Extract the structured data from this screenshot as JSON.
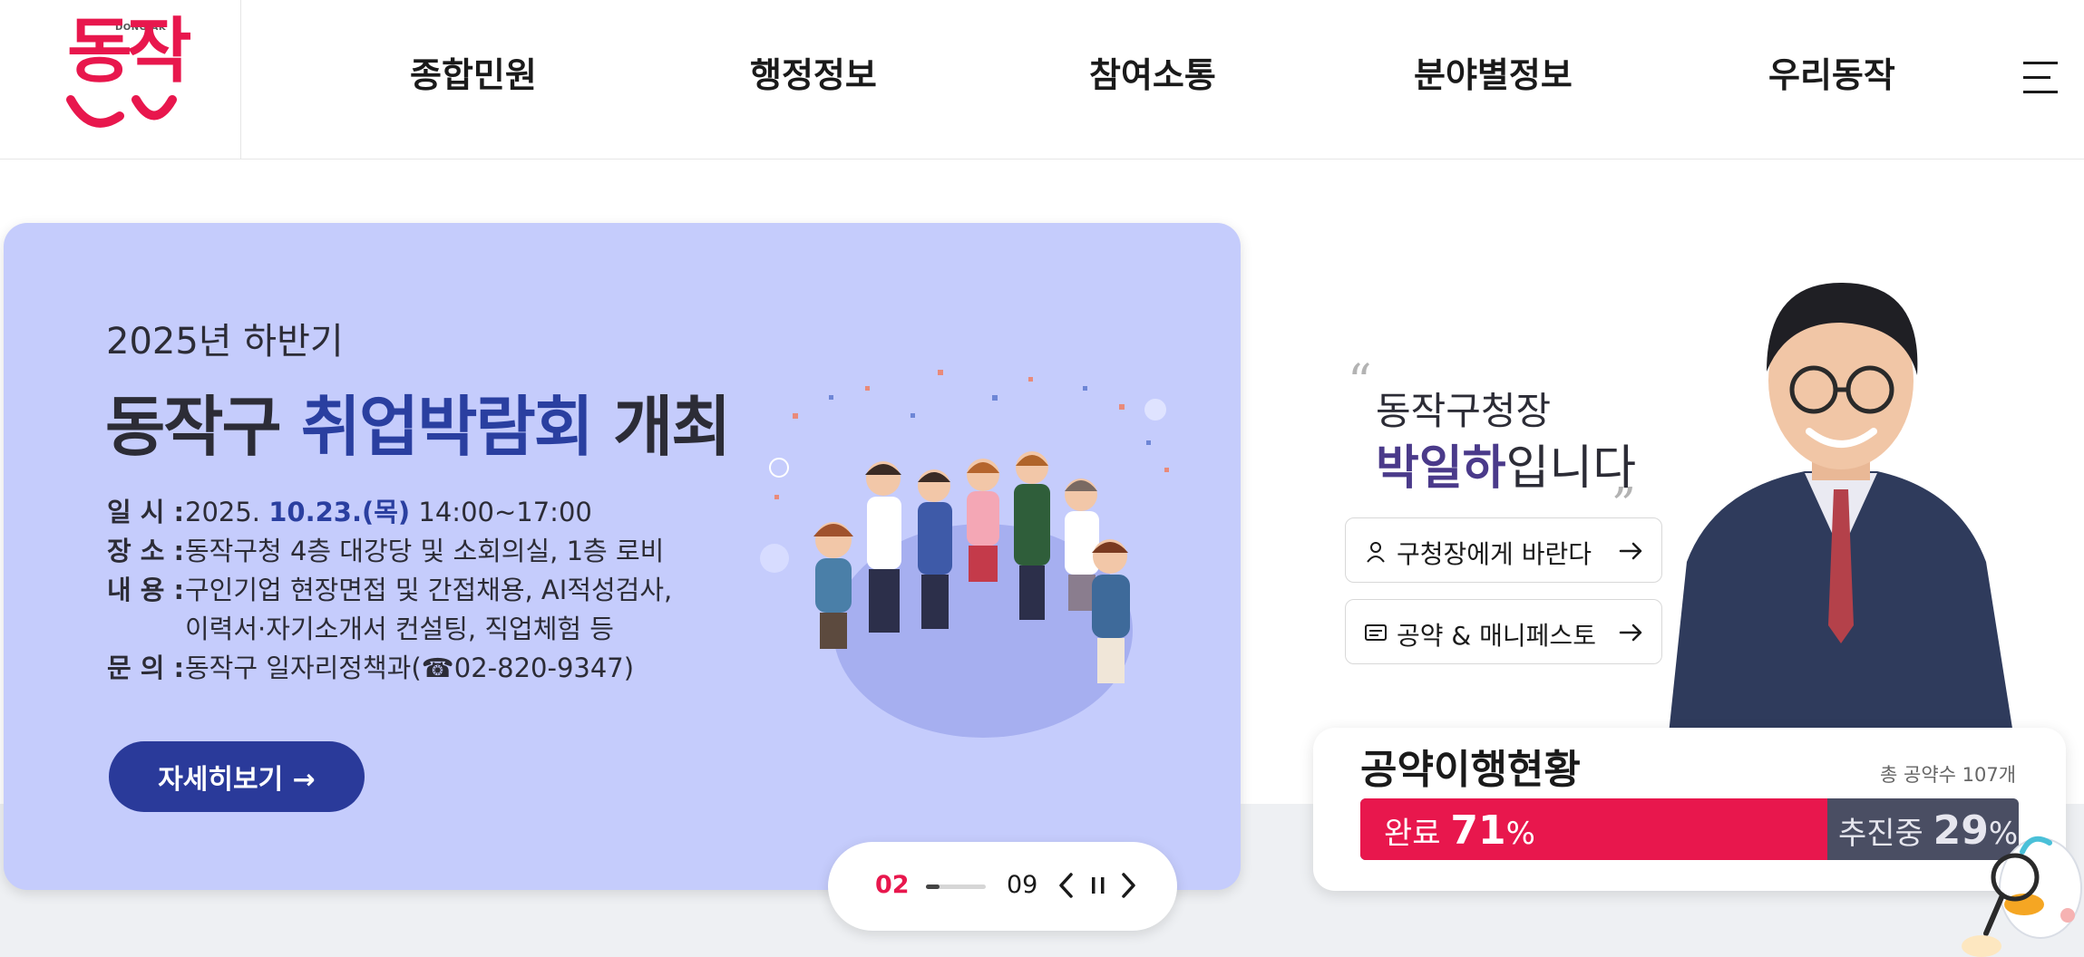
{
  "logo": {
    "tag": "DONGJAK",
    "text": "동작"
  },
  "nav": {
    "items": [
      "종합민원",
      "행정정보",
      "참여소통",
      "분야별정보",
      "우리동작"
    ],
    "menu_icon": "hamburger-icon"
  },
  "banner": {
    "subtitle": "2025년 하반기",
    "title_pre": "동작구 ",
    "title_accent": "취업박람회",
    "title_post": " 개최",
    "info": {
      "date_label": "일 시 :",
      "date_pre": "2025. ",
      "date_highlight": "10.23.(목)",
      "date_post": " 14:00~17:00",
      "place_label": "장 소 :",
      "place": "동작구청 4층 대강당 및 소회의실, 1층 로비",
      "content_label": "내 용 :",
      "content_line1": "구인기업 현장면접 및 간접채용, AI적성검사,",
      "content_line2": "이력서·자기소개서 컨설팅, 직업체험 등",
      "contact_label": "문 의 :",
      "contact": "동작구 일자리정책과(☎02-820-9347)"
    },
    "button_label": "자세히보기 →",
    "accent_color": "#2a3fa0",
    "bg_color": "#c5ccfc"
  },
  "pager": {
    "current": "02",
    "total": "09",
    "progress": 0.22,
    "icons": [
      "chevron-left-icon",
      "pause-icon",
      "chevron-right-icon"
    ]
  },
  "mayor": {
    "quote_open": "“",
    "line1": "동작구청장",
    "name": "박일하",
    "line2_post": "입니다",
    "quote_close": "„",
    "buttons": [
      {
        "label": "구청장에게 바란다",
        "icon": "person-icon"
      },
      {
        "label": "공약 & 매니페스토",
        "icon": "document-icon"
      }
    ]
  },
  "pledge": {
    "title": "공약이행현황",
    "total": "총 공약수 107개",
    "done_label": "완료",
    "done_value": "71",
    "done_unit": "%",
    "progress_label": "추진중",
    "progress_value": "29",
    "progress_unit": "%",
    "done_fraction": 0.71,
    "done_color": "#e8174d",
    "progress_color": "#4a4e63"
  }
}
